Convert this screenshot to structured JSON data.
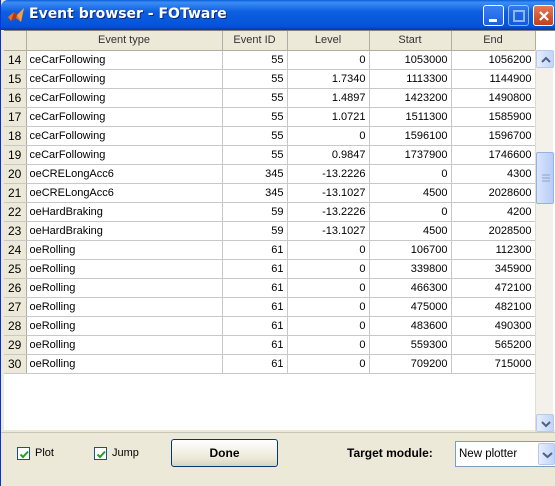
{
  "window": {
    "title": "Event browser - FOTware",
    "icon": "matlab-icon",
    "controls": [
      "minimize-icon",
      "maximize-icon",
      "close-icon"
    ]
  },
  "table": {
    "columns": [
      "Event type",
      "Event ID",
      "Level",
      "Start",
      "End"
    ],
    "rows": [
      {
        "n": "14",
        "type": "ceCarFollowing",
        "id": "55",
        "level": "0",
        "start": "1053000",
        "end": "1056200"
      },
      {
        "n": "15",
        "type": "ceCarFollowing",
        "id": "55",
        "level": "1.7340",
        "start": "1113300",
        "end": "1144900"
      },
      {
        "n": "16",
        "type": "ceCarFollowing",
        "id": "55",
        "level": "1.4897",
        "start": "1423200",
        "end": "1490800"
      },
      {
        "n": "17",
        "type": "ceCarFollowing",
        "id": "55",
        "level": "1.0721",
        "start": "1511300",
        "end": "1585900"
      },
      {
        "n": "18",
        "type": "ceCarFollowing",
        "id": "55",
        "level": "0",
        "start": "1596100",
        "end": "1596700"
      },
      {
        "n": "19",
        "type": "ceCarFollowing",
        "id": "55",
        "level": "0.9847",
        "start": "1737900",
        "end": "1746600"
      },
      {
        "n": "20",
        "type": "oeCRELongAcc6",
        "id": "345",
        "level": "-13.2226",
        "start": "0",
        "end": "4300"
      },
      {
        "n": "21",
        "type": "oeCRELongAcc6",
        "id": "345",
        "level": "-13.1027",
        "start": "4500",
        "end": "2028600"
      },
      {
        "n": "22",
        "type": "oeHardBraking",
        "id": "59",
        "level": "-13.2226",
        "start": "0",
        "end": "4200"
      },
      {
        "n": "23",
        "type": "oeHardBraking",
        "id": "59",
        "level": "-13.1027",
        "start": "4500",
        "end": "2028500"
      },
      {
        "n": "24",
        "type": "oeRolling",
        "id": "61",
        "level": "0",
        "start": "106700",
        "end": "112300"
      },
      {
        "n": "25",
        "type": "oeRolling",
        "id": "61",
        "level": "0",
        "start": "339800",
        "end": "345900"
      },
      {
        "n": "26",
        "type": "oeRolling",
        "id": "61",
        "level": "0",
        "start": "466300",
        "end": "472100"
      },
      {
        "n": "27",
        "type": "oeRolling",
        "id": "61",
        "level": "0",
        "start": "475000",
        "end": "482100"
      },
      {
        "n": "28",
        "type": "oeRolling",
        "id": "61",
        "level": "0",
        "start": "483600",
        "end": "490300"
      },
      {
        "n": "29",
        "type": "oeRolling",
        "id": "61",
        "level": "0",
        "start": "559300",
        "end": "565200"
      },
      {
        "n": "30",
        "type": "oeRolling",
        "id": "61",
        "level": "0",
        "start": "709200",
        "end": "715000"
      }
    ]
  },
  "footer": {
    "plot_label": "Plot",
    "plot_checked": true,
    "jump_label": "Jump",
    "jump_checked": true,
    "done_label": "Done",
    "target_label": "Target module:",
    "target_value": "New plotter"
  }
}
